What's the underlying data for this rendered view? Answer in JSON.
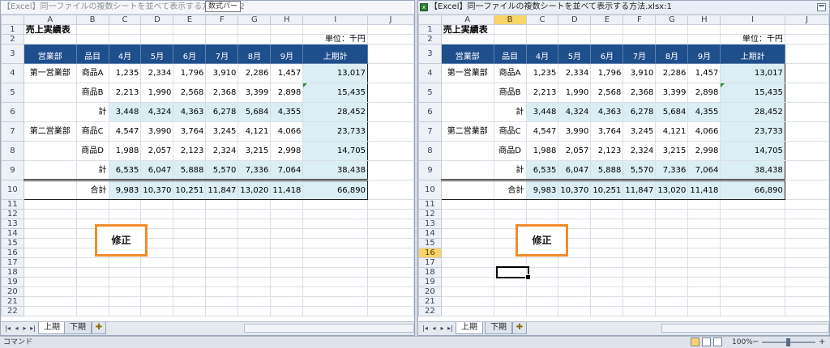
{
  "tooltip": "数式バー",
  "windows": [
    {
      "title": "【Excel】同一ファイルの複数シートを並べて表示する方法.xlsx:2",
      "active_row": null,
      "active_col": null
    },
    {
      "title": "【Excel】同一ファイルの複数シートを並べて表示する方法.xlsx:1",
      "active_row": "16",
      "active_col": "B"
    }
  ],
  "columns": [
    "A",
    "B",
    "C",
    "D",
    "E",
    "F",
    "G",
    "H",
    "I",
    "J"
  ],
  "rows": [
    "1",
    "2",
    "3",
    "4",
    "5",
    "6",
    "7",
    "8",
    "9",
    "10",
    "11",
    "12",
    "13",
    "14",
    "15",
    "16",
    "17",
    "18",
    "19",
    "20",
    "21",
    "22"
  ],
  "sheet": {
    "title": "売上実績表",
    "unit": "単位：千円",
    "headers": {
      "dept": "営業部",
      "item": "品目",
      "months": [
        "4月",
        "5月",
        "6月",
        "7月",
        "8月",
        "9月"
      ],
      "total": "上期計"
    },
    "body": [
      {
        "dept": "第一営業部",
        "item": "商品A",
        "values": [
          "1,235",
          "2,334",
          "1,796",
          "3,910",
          "2,286",
          "1,457"
        ],
        "total": "13,017"
      },
      {
        "dept": "",
        "item": "商品B",
        "values": [
          "2,213",
          "1,990",
          "2,568",
          "2,368",
          "3,399",
          "2,898"
        ],
        "total": "15,435"
      },
      {
        "dept": "",
        "item": "計",
        "values": [
          "3,448",
          "4,324",
          "4,363",
          "6,278",
          "5,684",
          "4,355"
        ],
        "total": "28,452"
      },
      {
        "dept": "第二営業部",
        "item": "商品C",
        "values": [
          "4,547",
          "3,990",
          "3,764",
          "3,245",
          "4,121",
          "4,066"
        ],
        "total": "23,733"
      },
      {
        "dept": "",
        "item": "商品D",
        "values": [
          "1,988",
          "2,057",
          "2,123",
          "2,324",
          "3,215",
          "2,998"
        ],
        "total": "14,705"
      },
      {
        "dept": "",
        "item": "計",
        "values": [
          "6,535",
          "6,047",
          "5,888",
          "5,570",
          "7,336",
          "7,064"
        ],
        "total": "38,438"
      },
      {
        "dept": "",
        "item": "合計",
        "values": [
          "9,983",
          "10,370",
          "10,251",
          "11,847",
          "13,020",
          "11,418"
        ],
        "total": "66,890"
      }
    ]
  },
  "note_box": "修正",
  "tabs": [
    "上期",
    "下期"
  ],
  "nav_icons": [
    "first-sheet-icon",
    "prev-sheet-icon",
    "next-sheet-icon",
    "last-sheet-icon"
  ],
  "status": {
    "mode": "コマンド",
    "zoom": "100%"
  },
  "colors": {
    "header_fill": "#1f4e8c",
    "subtotal_fill": "#daeef3",
    "note_border": "#f08c2b",
    "selected_header": "#f8d46a"
  }
}
